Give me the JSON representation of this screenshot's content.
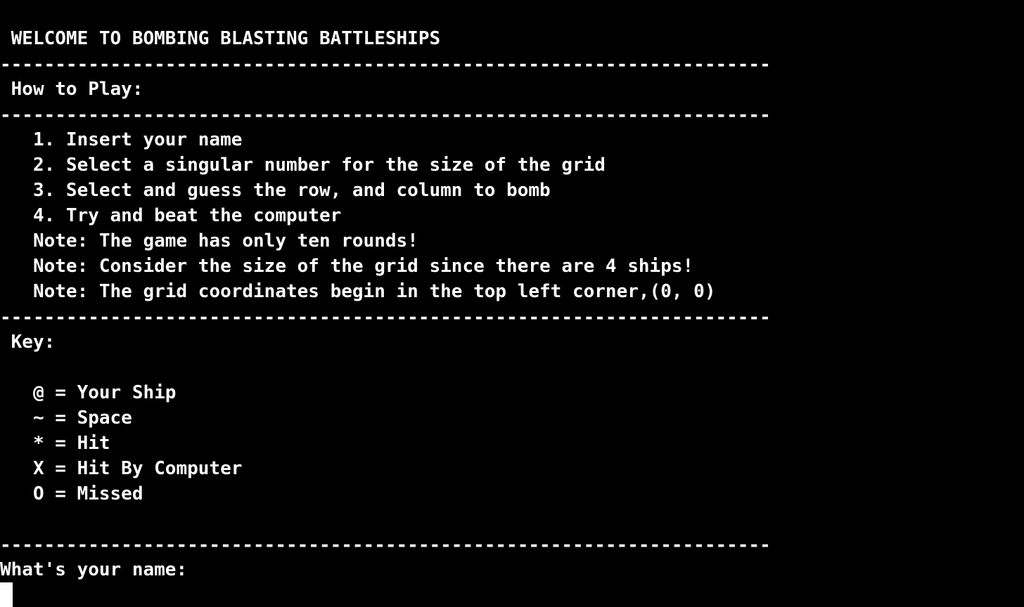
{
  "colors": {
    "background": "#000000",
    "text": "#ffffff",
    "cursor": "#ffffff"
  },
  "terminal": {
    "title_line": " WELCOME TO BOMBING BLASTING BATTLESHIPS",
    "rule": "----------------------------------------------------------------------",
    "how_to_play_heading": " How to Play:",
    "instructions": [
      "   1. Insert your name",
      "   2. Select a singular number for the size of the grid",
      "   3. Select and guess the row, and column to bomb",
      "   4. Try and beat the computer",
      "   Note: The game has only ten rounds!",
      "   Note: Consider the size of the grid since there are 4 ships!",
      "   Note: The grid coordinates begin in the top left corner,(0, 0)"
    ],
    "key_heading": " Key:",
    "key_items": [
      "   @ = Your Ship",
      "   ~ = Space",
      "   * = Hit",
      "   X = Hit By Computer",
      "   O = Missed"
    ],
    "prompt": "What's your name:",
    "input_value": ""
  }
}
